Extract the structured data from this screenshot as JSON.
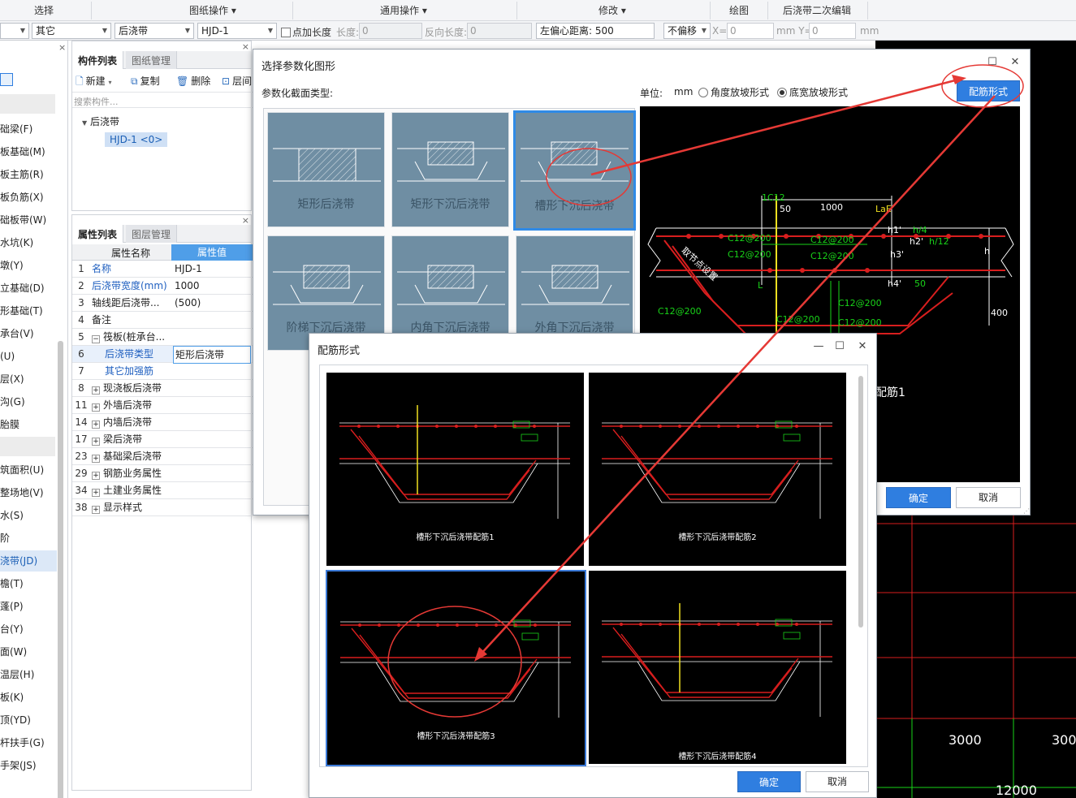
{
  "ribbon": {
    "groups": [
      "选择",
      "图纸操作",
      "通用操作",
      "修改",
      "绘图",
      "后浇带二次编辑"
    ]
  },
  "toolbar": {
    "dropdown1": "",
    "dropdown2": "其它",
    "dropdown3": "后浇带",
    "dropdown4": "HJD-1",
    "checkbox_label": "点加长度",
    "length_label": "长度:",
    "length_value": "0",
    "reverse_label": "反向长度:",
    "reverse_value": "0",
    "offset_label": "左偏心距离: 500",
    "nooffset": "不偏移",
    "x_label": "X=",
    "x_value": "0",
    "y_label": "mm Y=",
    "y_value": "0",
    "unit_mm": "mm"
  },
  "leftnav": {
    "items": [
      "础梁(F)",
      "板基础(M)",
      "板主筋(R)",
      "板负筋(X)",
      "础板带(W)",
      "水坑(K)",
      "墩(Y)",
      "立基础(D)",
      "形基础(T)",
      "承台(V)",
      "(U)",
      "层(X)",
      "沟(G)",
      "胎膜",
      "筑面积(U)",
      "整场地(V)",
      "水(S)",
      "阶",
      "浇带(JD)",
      "檐(T)",
      "蓬(P)",
      "台(Y)",
      "面(W)",
      "温层(H)",
      "板(K)",
      "顶(YD)",
      "杆扶手(G)",
      "手架(JS)"
    ],
    "selected": "浇带(JD)"
  },
  "component_panel": {
    "tab_active": "构件列表",
    "tab_other": "图纸管理",
    "new_label": "新建",
    "copy_label": "复制",
    "delete_label": "删除",
    "layer_label": "层间",
    "search_placeholder": "搜索构件...",
    "tree_root": "后浇带",
    "tree_item": "HJD-1 <0>"
  },
  "property_panel": {
    "tab_active": "属性列表",
    "tab_other": "图层管理",
    "header_name": "属性名称",
    "header_value": "属性值",
    "rows": [
      {
        "num": "1",
        "name": "名称",
        "value": "HJD-1"
      },
      {
        "num": "2",
        "name": "后浇带宽度(mm)",
        "value": "1000"
      },
      {
        "num": "3",
        "name": "轴线距后浇带...",
        "value": "(500)"
      },
      {
        "num": "4",
        "name": "备注",
        "value": ""
      },
      {
        "num": "5",
        "name": "筏板(桩承台...",
        "value": ""
      },
      {
        "num": "6",
        "name": "后浇带类型",
        "value": "矩形后浇带"
      },
      {
        "num": "7",
        "name": "其它加强筋",
        "value": ""
      },
      {
        "num": "8",
        "name": "现浇板后浇带",
        "value": ""
      },
      {
        "num": "11",
        "name": "外墙后浇带",
        "value": ""
      },
      {
        "num": "14",
        "name": "内墙后浇带",
        "value": ""
      },
      {
        "num": "17",
        "name": "梁后浇带",
        "value": ""
      },
      {
        "num": "23",
        "name": "基础梁后浇带",
        "value": ""
      },
      {
        "num": "29",
        "name": "钢筋业务属性",
        "value": ""
      },
      {
        "num": "34",
        "name": "土建业务属性",
        "value": ""
      },
      {
        "num": "38",
        "name": "显示样式",
        "value": ""
      }
    ]
  },
  "dialog_shape": {
    "title": "选择参数化图形",
    "section_label": "参数化截面类型:",
    "unit_label": "单位:",
    "unit_value": "mm",
    "radio1": "角度放坡形式",
    "radio2": "底宽放坡形式",
    "rebar_button": "配筋形式",
    "thumbs": [
      "矩形后浇带",
      "矩形下沉后浇带",
      "槽形下沉后浇带",
      "阶梯下沉后浇带",
      "内角下沉后浇带",
      "外角下沉后浇带"
    ],
    "selected_thumb": "槽形下沉后浇带",
    "preview_texts": {
      "c12": "1C12",
      "d50": "50",
      "d1000": "1000",
      "lae": "LaE",
      "h4": "h/4",
      "h12": "h/12",
      "h1": "h1'",
      "h2": "h2'",
      "h3": "h3'",
      "h4p": "h4'",
      "l": "L",
      "hh": "h",
      "d400": "400",
      "c1": "C12@200",
      "c2": "C12@200",
      "c3": "C12@200",
      "c4": "C12@200",
      "c5": "C12@200",
      "c6": "C12@200",
      "c7": "C12@200",
      "c8": "C12@200",
      "fifty": "50",
      "note": "取节点设置",
      "rebar1": "配筋1"
    },
    "ok": "确定",
    "cancel": "取消"
  },
  "dialog_rebar": {
    "title": "配筋形式",
    "captions": [
      "槽形下沉后浇带配筋1",
      "槽形下沉后浇带配筋2",
      "槽形下沉后浇带配筋3",
      "槽形下沉后浇带配筋4"
    ],
    "selected": "槽形下沉后浇带配筋3",
    "ok": "确定",
    "cancel": "取消"
  },
  "cad": {
    "dim1": "3000",
    "dim2": "300",
    "dim3": "12000"
  },
  "colors": {
    "accent": "#2f7ee0",
    "annotation": "#e53935",
    "cad_bg": "#000000",
    "cad_red": "#d81e1e",
    "cad_green": "#19d319",
    "thumb_bg": "#6f8ea3"
  }
}
